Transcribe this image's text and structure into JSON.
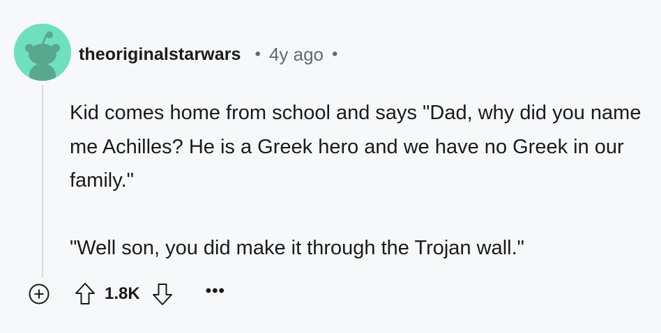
{
  "comment": {
    "author": "theoriginalstarwars",
    "separator": "•",
    "age": "4y ago",
    "trailing_separator": "•",
    "paragraphs": [
      "Kid comes home from school and says \"Dad, why did you name me Achilles? He is a Greek hero and we have no Greek in our family.\"",
      "\"Well son, you did make it through the Trojan wall.\""
    ],
    "score": "1.8K",
    "more_label": "•••"
  },
  "icons": {
    "avatar": "snoo-avatar-icon",
    "expand": "plus-circle-icon",
    "upvote": "upvote-arrow-icon",
    "downvote": "downvote-arrow-icon",
    "more": "ellipsis-icon"
  },
  "colors": {
    "background": "#f7f8f9",
    "avatar_bg": "#6ee0be",
    "text": "#1a1a1b",
    "meta": "#576f76",
    "thread_line": "#d5dadd"
  }
}
